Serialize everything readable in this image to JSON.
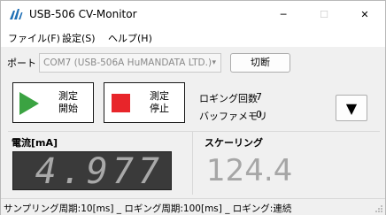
{
  "window": {
    "title": "USB-506 CV-Monitor",
    "controls": {
      "minimize": "─",
      "maximize": "☐",
      "close": "✕"
    }
  },
  "menu": {
    "items": [
      {
        "label": "ファイル(F)"
      },
      {
        "label": "設定(S)"
      },
      {
        "label": "ヘルプ(H)"
      }
    ]
  },
  "port": {
    "label": "ポート",
    "selected": "COM7 (USB-506A HuMANDATA LTD.)",
    "switch_label": "切断"
  },
  "controls": {
    "start_label_line1": "測定",
    "start_label_line2": "開始",
    "stop_label_line1": "測定",
    "stop_label_line2": "停止",
    "dropdown_glyph": "▼"
  },
  "stats": {
    "logging_count_label": "ロギング回数",
    "logging_count_value": "7",
    "buffer_memory_label": "バッファメモリ",
    "buffer_memory_value": "0"
  },
  "current": {
    "label": "電流[mA]",
    "value": "4.977"
  },
  "scaling": {
    "label": "スケーリング",
    "value": "124.4"
  },
  "status": {
    "text": "サンプリング周期:10[ms] _ ロギング周期:100[ms] _ ロギング:連続"
  },
  "colors": {
    "start_icon": "#3ba342",
    "stop_icon": "#e8252a",
    "lcd_background": "#3a3a3a",
    "lcd_digits": "#a9a9a9"
  }
}
